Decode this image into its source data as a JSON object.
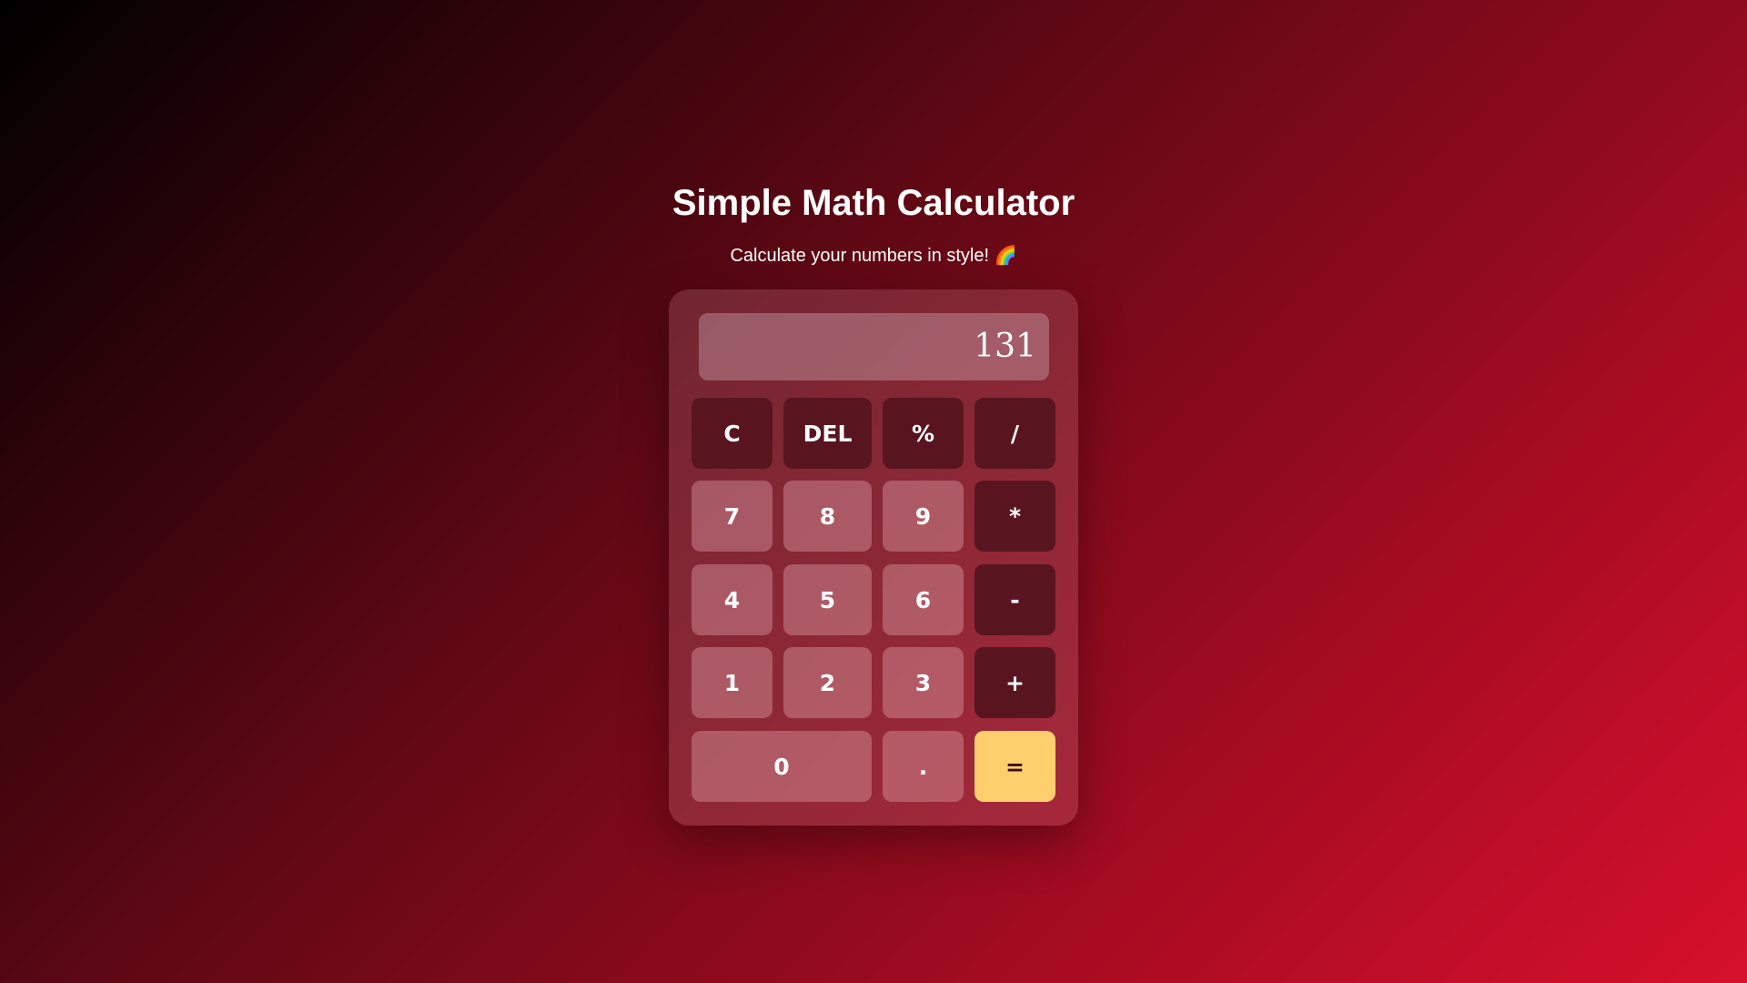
{
  "header": {
    "title": "Simple Math Calculator",
    "subtitle": "Calculate your numbers in style! 🌈"
  },
  "display": {
    "value": "131"
  },
  "buttons": {
    "clear": "C",
    "delete": "DEL",
    "percent": "%",
    "divide": "/",
    "seven": "7",
    "eight": "8",
    "nine": "9",
    "multiply": "*",
    "four": "4",
    "five": "5",
    "six": "6",
    "subtract": "-",
    "one": "1",
    "two": "2",
    "three": "3",
    "add": "+",
    "zero": "0",
    "decimal": ".",
    "equals": "="
  },
  "colors": {
    "background_start": "#000000",
    "background_end": "#d6102c",
    "operator_button": "#58151f",
    "equals_button": "#ffcf6e"
  }
}
